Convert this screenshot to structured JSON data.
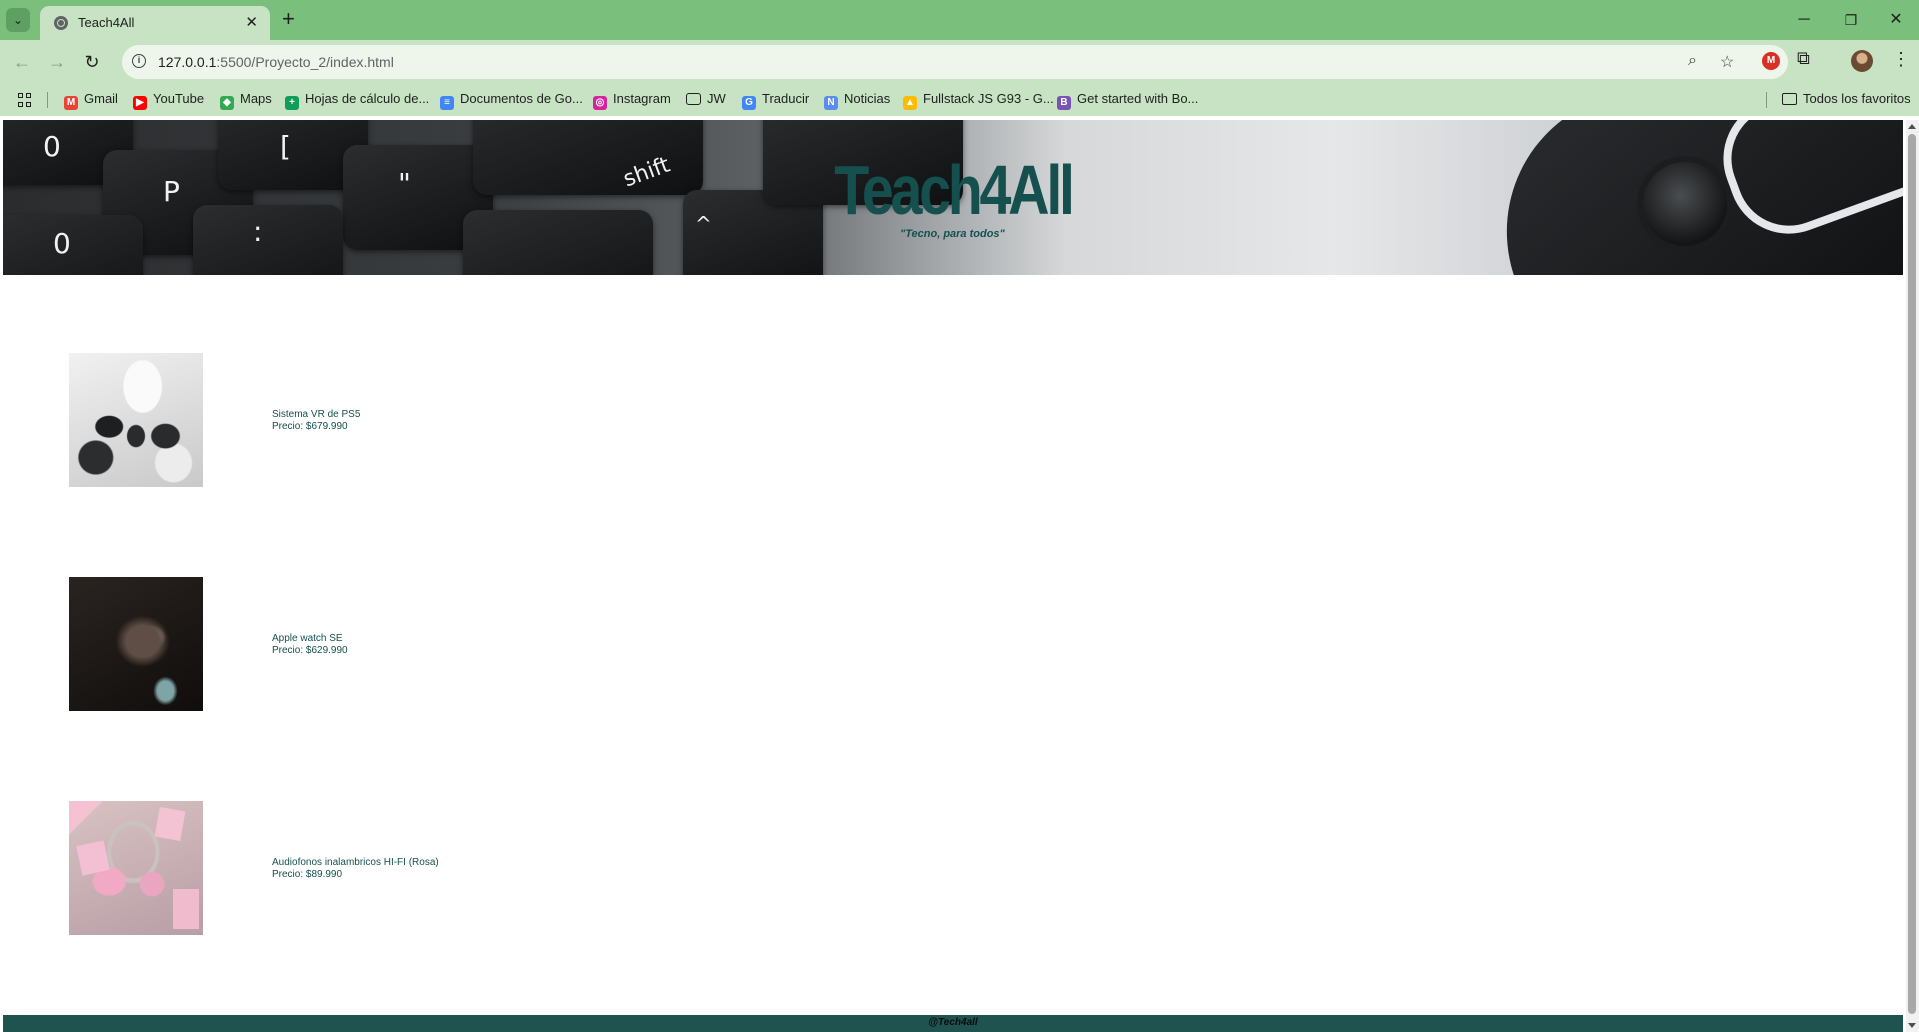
{
  "browser": {
    "tab_title": "Teach4All",
    "tab_close": "✕",
    "new_tab": "+",
    "url_host": "127.0.0.1",
    "url_path": ":5500/Proyecto_2/index.html",
    "window_controls": {
      "minimize": "─",
      "restore": "❐",
      "close": "✕"
    }
  },
  "bookmarks": [
    {
      "label": "Gmail",
      "icon": "gmail-icon",
      "color": "#ea4335",
      "glyph": "M"
    },
    {
      "label": "YouTube",
      "icon": "youtube-icon",
      "color": "#ff0000",
      "glyph": "▶"
    },
    {
      "label": "Maps",
      "icon": "maps-icon",
      "color": "#34a853",
      "glyph": "◆"
    },
    {
      "label": "Hojas de cálculo de...",
      "icon": "sheets-icon",
      "color": "#0f9d58",
      "glyph": "+"
    },
    {
      "label": "Documentos de Go...",
      "icon": "docs-icon",
      "color": "#4285f4",
      "glyph": "≡"
    },
    {
      "label": "Instagram",
      "icon": "instagram-icon",
      "color": "#d6249f",
      "glyph": "◎"
    },
    {
      "label": "JW",
      "icon": "folder-icon",
      "color": "#c7e3c3",
      "glyph": "▭"
    },
    {
      "label": "Traducir",
      "icon": "translate-icon",
      "color": "#4285f4",
      "glyph": "G"
    },
    {
      "label": "Noticias",
      "icon": "news-icon",
      "color": "#5b8def",
      "glyph": "N"
    },
    {
      "label": "Fullstack JS G93 - G...",
      "icon": "drive-icon",
      "color": "#fbbc04",
      "glyph": "▲"
    },
    {
      "label": "Get started with Bo...",
      "icon": "bootstrap-icon",
      "color": "#7952b3",
      "glyph": "B"
    }
  ],
  "all_favorites": "Todos los favoritos",
  "hero": {
    "title": "Teach4All",
    "tagline": "\"Tecno, para todos\"",
    "keys": [
      "0",
      "P",
      "[",
      "\"",
      "shift",
      ":",
      "^",
      "0"
    ]
  },
  "products": [
    {
      "name": "Sistema VR de PS5",
      "price": "Precio: $679.990"
    },
    {
      "name": "Apple watch SE",
      "price": "Precio: $629.990"
    },
    {
      "name": "Audiofonos inalambricos HI-FI (Rosa)",
      "price": "Precio: $89.990"
    }
  ],
  "footer": "@Tech4all",
  "colors": {
    "accent": "#15504f",
    "footer_bg": "#1f5350",
    "chrome": "#7bbf7c"
  }
}
